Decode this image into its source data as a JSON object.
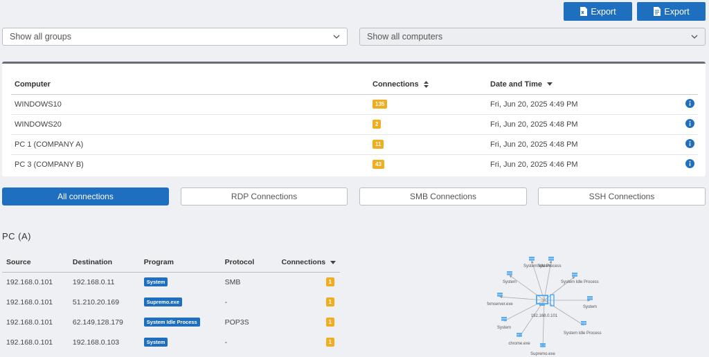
{
  "toolbar": {
    "export1_label": "Export",
    "export2_label": "Export"
  },
  "filters": {
    "groups_value": "Show all groups",
    "computers_value": "Show all computers"
  },
  "computers_table": {
    "headers": {
      "computer": "Computer",
      "connections": "Connections",
      "date": "Date and Time"
    },
    "rows": [
      {
        "computer": "WINDOWS10",
        "connections": "135",
        "date": "Fri, Jun 20, 2025 4:49 PM"
      },
      {
        "computer": "WINDOWS20",
        "connections": "2",
        "date": "Fri, Jun 20, 2025 4:48 PM"
      },
      {
        "computer": "PC 1 (COMPANY A)",
        "connections": "11",
        "date": "Fri, Jun 20, 2025 4:48 PM"
      },
      {
        "computer": "PC 3 (COMPANY B)",
        "connections": "43",
        "date": "Fri, Jun 20, 2025 4:46 PM"
      }
    ]
  },
  "tabs": [
    {
      "label": "All connections",
      "active": true
    },
    {
      "label": "RDP Connections",
      "active": false
    },
    {
      "label": "SMB Connections",
      "active": false
    },
    {
      "label": "SSH Connections",
      "active": false
    }
  ],
  "detail": {
    "title": "PC (A)",
    "headers": {
      "source": "Source",
      "destination": "Destination",
      "program": "Program",
      "protocol": "Protocol",
      "connections": "Connections"
    },
    "rows": [
      {
        "source": "192.168.0.101",
        "destination": "192.168.0.11",
        "program": "System",
        "protocol": "SMB",
        "connections": "1"
      },
      {
        "source": "192.168.0.101",
        "destination": "51.210.20.169",
        "program": "Supremo.exe",
        "protocol": "-",
        "connections": "1"
      },
      {
        "source": "192.168.0.101",
        "destination": "62.149.128.179",
        "program": "System Idle Process",
        "protocol": "POP3S",
        "connections": "1"
      },
      {
        "source": "192.168.0.101",
        "destination": "192.168.0.103",
        "program": "System",
        "protocol": "-",
        "connections": "1"
      }
    ]
  },
  "graph": {
    "center_label": "192.168.0.101",
    "nodes": [
      {
        "label": "System"
      },
      {
        "label": "System Idle Process"
      },
      {
        "label": "System"
      },
      {
        "label": "System Idle Process"
      },
      {
        "label": "System"
      },
      {
        "label": "System Idle Process"
      },
      {
        "label": "Supremo.exe"
      },
      {
        "label": "chrome.exe"
      },
      {
        "label": "System"
      },
      {
        "label": "fxmserver.exe"
      }
    ]
  },
  "colors": {
    "primary": "#1e6fbf",
    "badge": "#f0ad1f",
    "node": "#5aaef0"
  }
}
